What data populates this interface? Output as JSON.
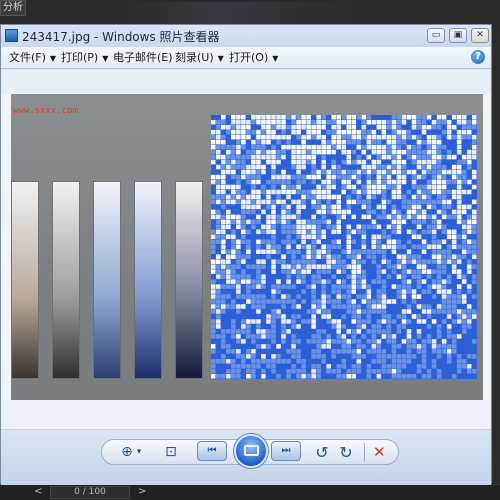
{
  "background_app": {
    "tab_label": "分析",
    "page_counter": "0 / 100",
    "prev_arrow": "<",
    "next_arrow": ">"
  },
  "window": {
    "title": "243417.jpg - Windows 照片查看器",
    "minimize_glyph": "▭",
    "maximize_glyph": "▣",
    "close_glyph": "✕"
  },
  "menu": {
    "items": [
      {
        "label": "文件(F)",
        "caret": "▼"
      },
      {
        "label": "打印(P)",
        "caret": "▼"
      },
      {
        "label": "电子邮件(E)",
        "caret": ""
      },
      {
        "label": "刻录(U)",
        "caret": "▼"
      },
      {
        "label": "打开(O)",
        "caret": "▼"
      }
    ],
    "help_glyph": "?"
  },
  "photo": {
    "watermark_top": "www.sxxx.com",
    "watermark_bottom": "",
    "strips": [
      {
        "name": "strip-warm",
        "top": "#f2f2f2",
        "mid": "#b8a799",
        "bottom": "#3a3431"
      },
      {
        "name": "strip-gray",
        "top": "#f2f2f2",
        "mid": "#9b9b9b",
        "bottom": "#2f2f2f"
      },
      {
        "name": "strip-light-blue",
        "top": "#f2f5fb",
        "mid": "#8ea6cf",
        "bottom": "#2c3f70"
      },
      {
        "name": "strip-blue",
        "top": "#f1f4fb",
        "mid": "#7f97cf",
        "bottom": "#1d2f6b"
      },
      {
        "name": "strip-navy",
        "top": "#f3f3f3",
        "mid": "#7a7f98",
        "bottom": "#131a3a"
      }
    ],
    "mosaic_colors": {
      "light": "#e9eef9",
      "mid": "#6a92e6",
      "deep": "#2d5fd6",
      "white": "#ffffff"
    }
  },
  "controls": {
    "zoom_icon": "⊕",
    "zoom_caret": "▾",
    "fit_icon": "⊡",
    "prev_icon": "⏮",
    "next_icon": "⏭",
    "rotate_ccw_icon": "↺",
    "rotate_cw_icon": "↻",
    "delete_icon": "✕"
  }
}
